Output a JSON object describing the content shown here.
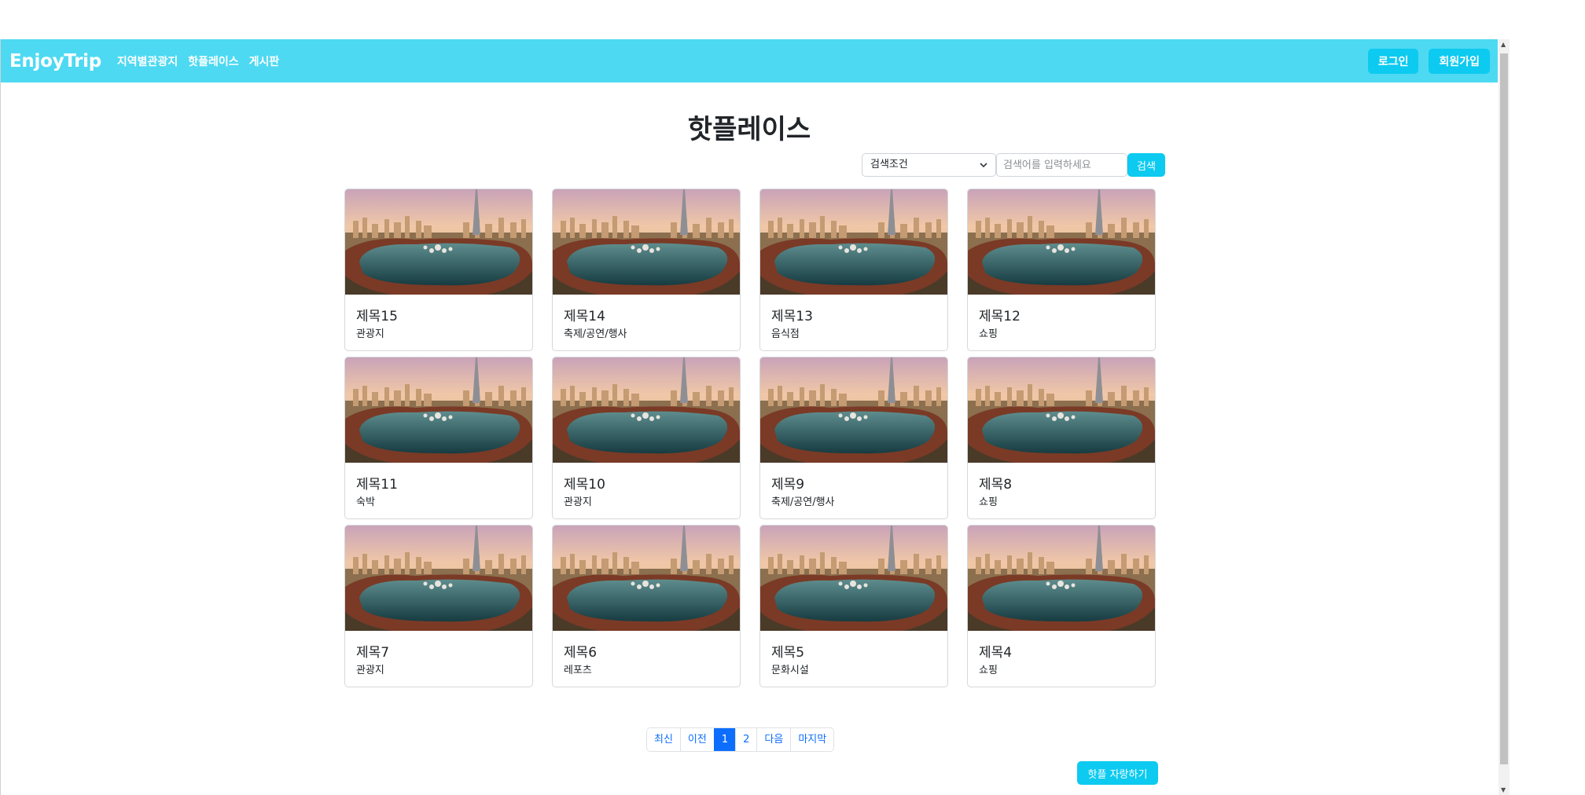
{
  "navbar": {
    "brand": "EnjoyTrip",
    "links": [
      "지역별관광지",
      "핫플레이스",
      "게시판"
    ],
    "login": "로그인",
    "signup": "회원가입",
    "bg_color": "#4dd9f2"
  },
  "main": {
    "title": "핫플레이스",
    "search": {
      "select_value": "검색조건",
      "placeholder": "검색어를 입력하세요",
      "button": "검색"
    },
    "cards": [
      {
        "title": "제목15",
        "category": "관광지"
      },
      {
        "title": "제목14",
        "category": "축제/공연/행사"
      },
      {
        "title": "제목13",
        "category": "음식점"
      },
      {
        "title": "제목12",
        "category": "쇼핑"
      },
      {
        "title": "제목11",
        "category": "숙박"
      },
      {
        "title": "제목10",
        "category": "관광지"
      },
      {
        "title": "제목9",
        "category": "축제/공연/행사"
      },
      {
        "title": "제목8",
        "category": "쇼핑"
      },
      {
        "title": "제목7",
        "category": "관광지"
      },
      {
        "title": "제목6",
        "category": "레포츠"
      },
      {
        "title": "제목5",
        "category": "문화시설"
      },
      {
        "title": "제목4",
        "category": "쇼핑"
      }
    ],
    "pagination": [
      "최신",
      "이전",
      "1",
      "2",
      "다음",
      "마지막"
    ],
    "active_page": "1",
    "brag_button": "핫플 자랑하기"
  },
  "colors": {
    "accent": "#0dcaf0",
    "primary": "#0d6efd"
  }
}
